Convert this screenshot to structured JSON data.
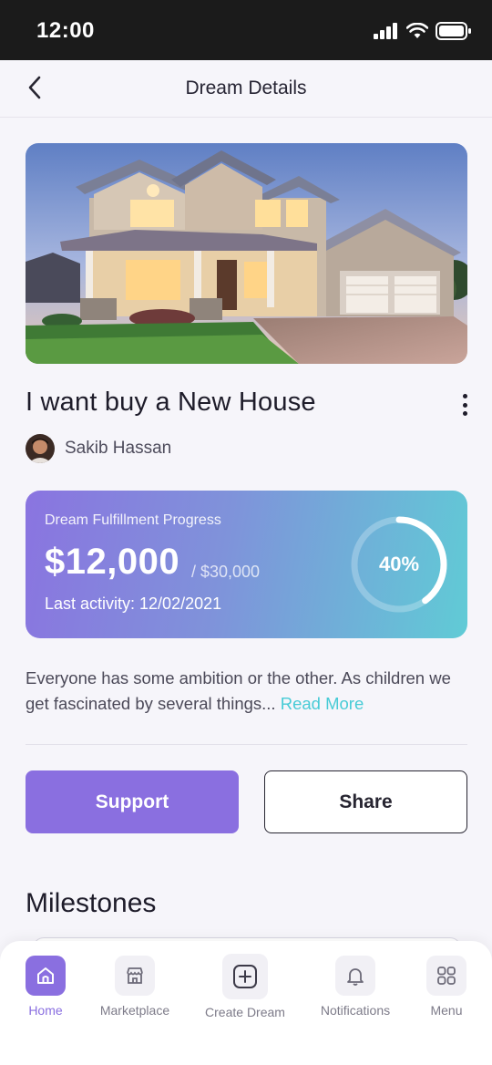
{
  "status_bar": {
    "time": "12:00"
  },
  "header": {
    "title": "Dream Details"
  },
  "dream": {
    "title": "I want buy a New House",
    "author": "Sakib Hassan",
    "image": "house-photo"
  },
  "progress": {
    "label": "Dream Fulfillment Progress",
    "raised": "$12,000",
    "goal": "/ $30,000",
    "last_activity": "Last activity: 12/02/2021",
    "percent_text": "40%",
    "percent_value": 0.4
  },
  "description": {
    "text": "Everyone has some ambition or the other. As children we get fascinated by several things... ",
    "read_more": "Read More"
  },
  "actions": {
    "support": "Support",
    "share": "Share"
  },
  "milestones": {
    "title": "Milestones"
  },
  "bottom_nav": {
    "items": [
      {
        "label": "Home",
        "icon": "home-icon",
        "active": true
      },
      {
        "label": "Marketplace",
        "icon": "store-icon",
        "active": false
      },
      {
        "label": "Create Dream",
        "icon": "plus-square-icon",
        "active": false
      },
      {
        "label": "Notifications",
        "icon": "bell-icon",
        "active": false
      },
      {
        "label": "Menu",
        "icon": "grid-icon",
        "active": false
      }
    ]
  },
  "colors": {
    "accent": "#8a6fe0",
    "teal": "#47cbd6",
    "dark": "#1e1c2a"
  }
}
